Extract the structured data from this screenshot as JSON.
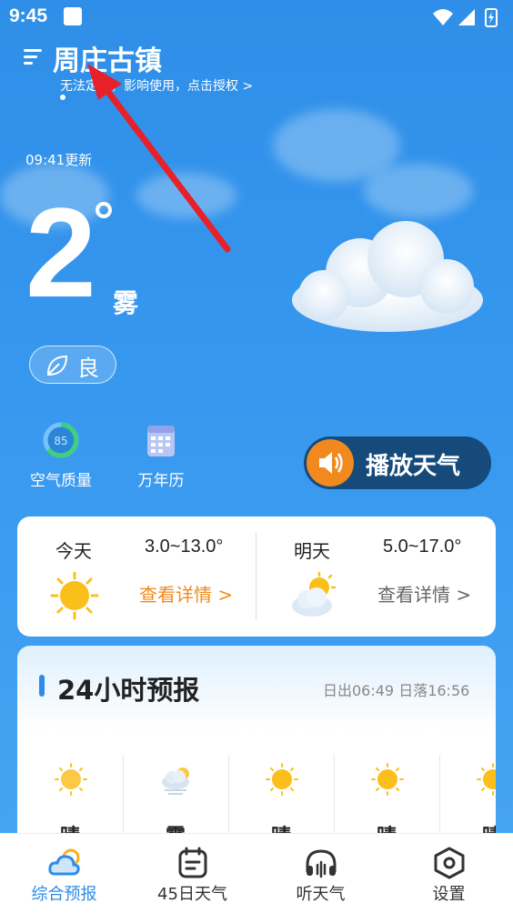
{
  "status_bar": {
    "time": "9:45"
  },
  "header": {
    "city": "周庄古镇",
    "auth_tip": "无法定位，影响使用，点击授权 >"
  },
  "current": {
    "updated": "09:41更新",
    "temperature": "2",
    "condition": "雾",
    "aqi_label": "良"
  },
  "tools": {
    "air_quality": {
      "label": "空气质量",
      "value": "85"
    },
    "calendar": {
      "label": "万年历"
    },
    "play_weather": "播放天气"
  },
  "daily": [
    {
      "name": "今天",
      "range": "3.0~13.0°",
      "link": "查看详情 >",
      "icon": "sun-icon",
      "link_color": "#f08a1e"
    },
    {
      "name": "明天",
      "range": "5.0~17.0°",
      "link": "查看详情 >",
      "icon": "sun-cloud-icon",
      "link_color": "#666666"
    }
  ],
  "hourly": {
    "title": "24小时预报",
    "sun_times": "日出06:49  日落16:56",
    "items": [
      {
        "cond": "晴",
        "icon": "sun-icon"
      },
      {
        "cond": "雾",
        "icon": "fog-icon"
      },
      {
        "cond": "晴",
        "icon": "sun-icon"
      },
      {
        "cond": "晴",
        "icon": "sun-icon"
      },
      {
        "cond": "晴",
        "icon": "sun-icon"
      }
    ]
  },
  "tabs": [
    {
      "label": "综合预报",
      "icon": "cloud-icon",
      "active": true
    },
    {
      "label": "45日天气",
      "icon": "calendar-icon",
      "active": false
    },
    {
      "label": "听天气",
      "icon": "headphones-icon",
      "active": false
    },
    {
      "label": "设置",
      "icon": "settings-icon",
      "active": false
    }
  ],
  "colors": {
    "accent": "#2d8de6",
    "orange": "#f08a1e",
    "annotation_arrow": "#e8202a"
  }
}
